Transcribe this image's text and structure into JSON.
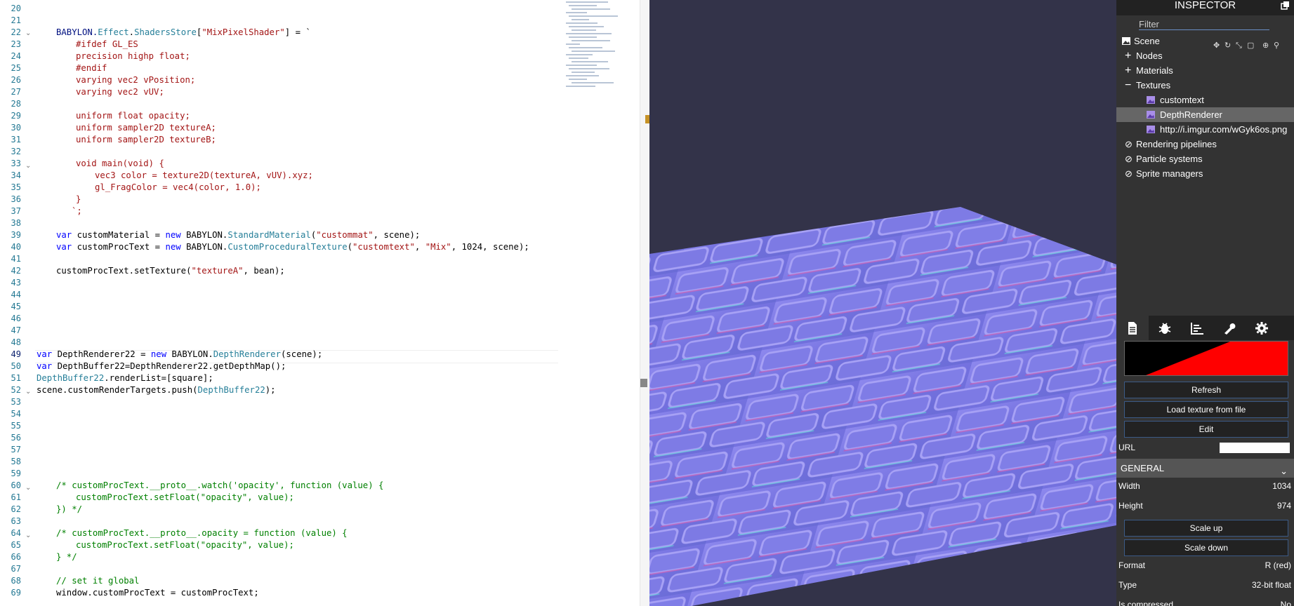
{
  "editor": {
    "line_numbers": [
      "20",
      "21",
      "22",
      "23",
      "24",
      "25",
      "26",
      "27",
      "28",
      "29",
      "30",
      "31",
      "32",
      "33",
      "34",
      "35",
      "36",
      "37",
      "38",
      "39",
      "40",
      "41",
      "42",
      "43",
      "44",
      "45",
      "46",
      "47",
      "48",
      "49",
      "50",
      "51",
      "52",
      "53",
      "54",
      "55",
      "56",
      "57",
      "58",
      "59",
      "60",
      "61",
      "62",
      "63",
      "64",
      "65",
      "66",
      "67",
      "68",
      "69"
    ],
    "lines": {
      "l22_a": "BABYLON.",
      "l22_b": "Effect",
      "l22_c": ".",
      "l22_d": "ShadersStore",
      "l22_e": "[",
      "l22_f": "\"MixPixelShader\"",
      "l22_g": "] = `",
      "l23": "#ifdef GL_ES",
      "l24": "precision highp float;",
      "l25": "#endif",
      "l26": "varying vec2 vPosition;",
      "l27": "varying vec2 vUV;",
      "l29": "uniform float opacity;",
      "l30": "uniform sampler2D textureA;",
      "l31": "uniform sampler2D textureB;",
      "l33": "void main(void) {",
      "l34": "vec3 color = texture2D(textureA, vUV).xyz;",
      "l35": "gl_FragColor = vec4(color, 1.0);",
      "l36": "}",
      "l37": "`;",
      "l39_kw": "var",
      "l39_a": " customMaterial = ",
      "l39_new": "new",
      "l39_b": " BABYLON.",
      "l39_t": "StandardMaterial",
      "l39_c": "(",
      "l39_s": "\"custommat\"",
      "l39_d": ", scene);",
      "l40_kw": "var",
      "l40_a": " customProcText = ",
      "l40_new": "new",
      "l40_b": " BABYLON.",
      "l40_t": "CustomProceduralTexture",
      "l40_c": "(",
      "l40_s1": "\"customtext\"",
      "l40_d": ", ",
      "l40_s2": "\"Mix\"",
      "l40_e": ", 1024, scene);",
      "l42_a": "customProcText.setTexture(",
      "l42_s": "\"textureA\"",
      "l42_b": ", bean);",
      "l49_kw": "var",
      "l49_a": " DepthRenderer22 = ",
      "l49_new": "new",
      "l49_b": " BABYLON.",
      "l49_t": "DepthRenderer",
      "l49_c": "(scene);",
      "l50_kw": "var",
      "l50_a": " DepthBuffer22=DepthRenderer22.getDepthMap();",
      "l51_t": "DepthBuffer22",
      "l51_a": ".renderList=[square];",
      "l52_a": "scene.customRenderTargets.push(",
      "l52_t": "DepthBuffer22",
      "l52_b": ");",
      "l60": "/* customProcText.__proto__.watch('opacity', function (value) {",
      "l61": "customProcText.setFloat(\"opacity\", value);",
      "l62": "}) */",
      "l64": "/* customProcText.__proto__.opacity = function (value) {",
      "l65": "customProcText.setFloat(\"opacity\", value);",
      "l66": "} */",
      "l68": "// set it global",
      "l69": "window.customProcText = customProcText;"
    }
  },
  "viewport": {
    "background": "#333349",
    "ground_colors": [
      "#7d79e6",
      "#6c6ad8",
      "#a99cf2"
    ]
  },
  "inspector": {
    "title": "INSPECTOR",
    "filter_placeholder": "Filter",
    "tree": {
      "scene": "Scene",
      "nodes": "Nodes",
      "materials": "Materials",
      "textures": "Textures",
      "tex_customtext": "customtext",
      "tex_depth": "DepthRenderer",
      "tex_url": "http://i.imgur.com/wGyk6os.png",
      "pipelines": "Rendering pipelines",
      "particles": "Particle systems",
      "sprites": "Sprite managers"
    },
    "expand_plus": "+",
    "expand_minus": "−",
    "tabs": [
      "properties-tab",
      "debug-tab",
      "statistics-tab",
      "tools-tab",
      "settings-tab"
    ],
    "buttons": {
      "refresh": "Refresh",
      "load": "Load texture from file",
      "edit": "Edit",
      "scale_up": "Scale up",
      "scale_down": "Scale down"
    },
    "url_label": "URL",
    "general_title": "GENERAL",
    "props": {
      "width_k": "Width",
      "width_v": "1034",
      "height_k": "Height",
      "height_v": "974",
      "format_k": "Format",
      "format_v": "R (red)",
      "type_k": "Type",
      "type_v": "32-bit float",
      "compressed_k": "Is compressed",
      "compressed_v": "No"
    },
    "colors": {
      "panel": "#333333",
      "header": "#222222",
      "selected": "#666666",
      "accent": "#3b5a86",
      "preview_red": "#ff0000"
    }
  }
}
